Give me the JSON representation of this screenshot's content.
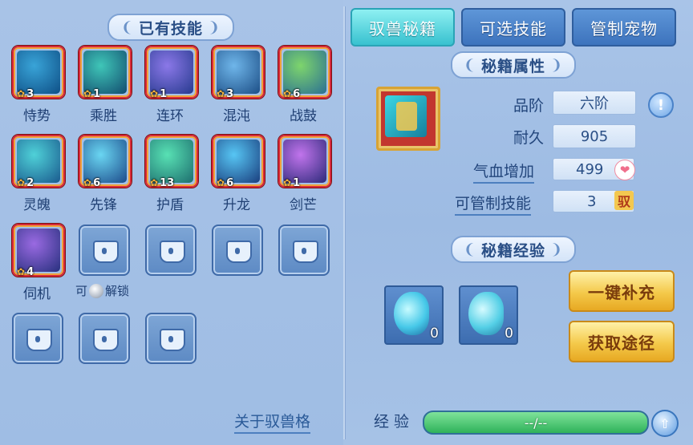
{
  "left": {
    "title": "已有技能",
    "skills": [
      {
        "name": "恃势",
        "level": "3",
        "colors": [
          "#39a4d8",
          "#0e4f86"
        ]
      },
      {
        "name": "乘胜",
        "level": "1",
        "colors": [
          "#3fc6b8",
          "#124b6e"
        ]
      },
      {
        "name": "连环",
        "level": "1",
        "colors": [
          "#8b78e8",
          "#263a8e"
        ]
      },
      {
        "name": "混沌",
        "level": "3",
        "colors": [
          "#6fb6ea",
          "#1c4e86"
        ]
      },
      {
        "name": "战鼓",
        "level": "6",
        "colors": [
          "#7ed56c",
          "#2a6f93"
        ]
      },
      {
        "name": "灵魄",
        "level": "2",
        "colors": [
          "#4fd1d8",
          "#1a5a8e"
        ]
      },
      {
        "name": "先锋",
        "level": "6",
        "colors": [
          "#6ad6f2",
          "#1c4a8a"
        ]
      },
      {
        "name": "护盾",
        "level": "13",
        "colors": [
          "#58e1b4",
          "#1d6e6e"
        ]
      },
      {
        "name": "升龙",
        "level": "6",
        "colors": [
          "#57c6f4",
          "#1a3e7e"
        ]
      },
      {
        "name": "剑芒",
        "level": "1",
        "colors": [
          "#c174ec",
          "#2c2a7a"
        ]
      },
      {
        "name": "伺机",
        "level": "4",
        "colors": [
          "#9a6ae2",
          "#27307e"
        ]
      }
    ],
    "unlock_prefix": "可",
    "unlock_suffix": "解锁",
    "about_link": "关于驭兽格"
  },
  "tabs": [
    {
      "label": "驭兽秘籍",
      "active": true
    },
    {
      "label": "可选技能",
      "active": false
    },
    {
      "label": "管制宠物",
      "active": false
    }
  ],
  "attributes": {
    "title": "秘籍属性",
    "grade_label": "品阶",
    "grade_value": "六阶",
    "durability_label": "耐久",
    "durability_value": "905",
    "hp_label": "气血增加",
    "hp_value": "499",
    "control_label": "可管制技能",
    "control_value": "3",
    "control_badge": "驭",
    "info_icon": "!"
  },
  "experience": {
    "title": "秘籍经验",
    "items": [
      {
        "count": "0"
      },
      {
        "count": "0"
      }
    ],
    "refill_button": "一键补充",
    "source_button": "获取途径",
    "exp_label": "经验",
    "exp_value": "--/--"
  }
}
